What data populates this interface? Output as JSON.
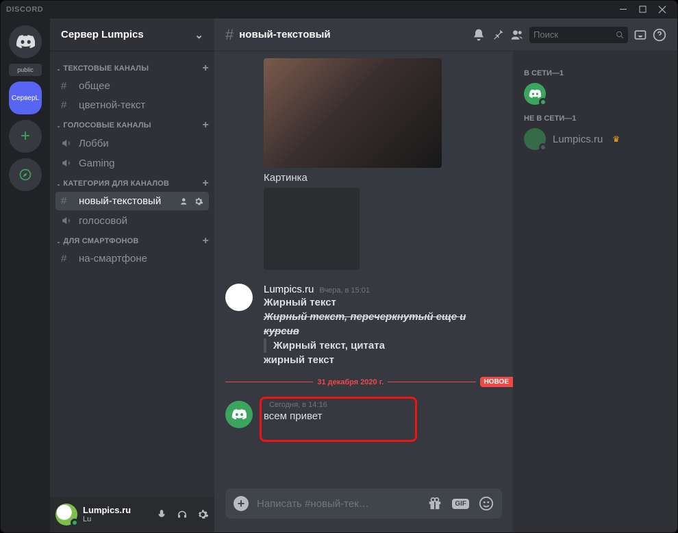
{
  "app_name": "DISCORD",
  "guilds": {
    "public_label": "public",
    "active_name": "СерверL"
  },
  "server": {
    "name": "Сервер Lumpics"
  },
  "categories": [
    {
      "name": "ТЕКСТОВЫЕ КАНАЛЫ",
      "channels": [
        {
          "type": "text",
          "name": "общее"
        },
        {
          "type": "text",
          "name": "цветной-текст"
        }
      ]
    },
    {
      "name": "ГОЛОСОВЫЕ КАНАЛЫ",
      "channels": [
        {
          "type": "voice",
          "name": "Лобби"
        },
        {
          "type": "voice",
          "name": "Gaming"
        }
      ]
    },
    {
      "name": "КАТЕГОРИЯ ДЛЯ КАНАЛОВ",
      "channels": [
        {
          "type": "text",
          "name": "новый-текстовый",
          "active": true
        },
        {
          "type": "voice",
          "name": "голосовой"
        }
      ]
    },
    {
      "name": "ДЛЯ СМАРТФОНОВ",
      "channels": [
        {
          "type": "text",
          "name": "на-смартфоне"
        }
      ]
    }
  ],
  "current_user": {
    "name": "Lumpics.ru",
    "tag": "Lu"
  },
  "channel_header": {
    "name": "новый-текстовый",
    "search_placeholder": "Поиск"
  },
  "chat": {
    "image_caption": "Картинка",
    "msg1": {
      "author": "Lumpics.ru",
      "time": "Вчера, в 15:01",
      "line1": "Жирный текст",
      "line2": "Жирный текст, перечеркнутый еще и курсив",
      "line3": "Жирный текст, цитата",
      "line4": "жирный текст"
    },
    "divider_date": "31 декабря 2020 г.",
    "divider_new": "НОВОЕ",
    "msg2": {
      "author": "",
      "time": "Сегодня, в 14:16",
      "line1": "всем привет"
    },
    "composer_placeholder": "Написать #новый-тек…",
    "gif_label": "GIF"
  },
  "members": {
    "online_header": "В СЕТИ—1",
    "offline_header": "НЕ В СЕТИ—1",
    "offline_member": "Lumpics.ru"
  }
}
